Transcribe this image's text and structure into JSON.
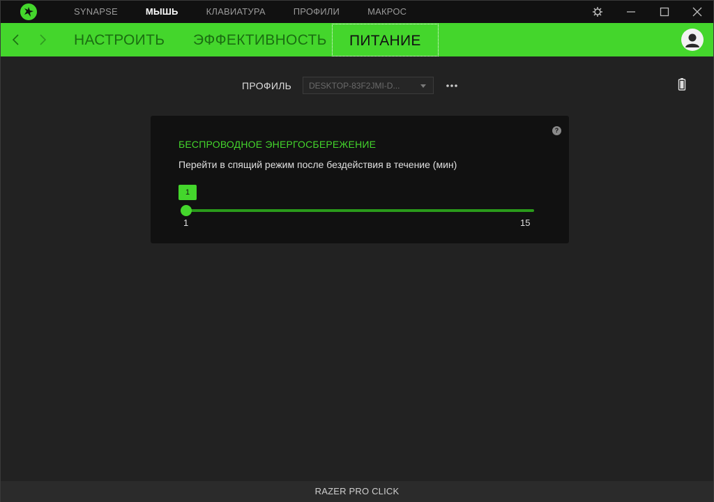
{
  "topnav": {
    "items": [
      {
        "label": "SYNAPSE",
        "active": false
      },
      {
        "label": "МЫШЬ",
        "active": true
      },
      {
        "label": "КЛАВИАТУРА",
        "active": false
      },
      {
        "label": "ПРОФИЛИ",
        "active": false
      },
      {
        "label": "МАКРОС",
        "active": false
      }
    ]
  },
  "subnav": {
    "tabs": [
      {
        "label": "НАСТРОИТЬ",
        "active": false
      },
      {
        "label": "ЭФФЕКТИВНОСТЬ",
        "active": false
      },
      {
        "label": "ПИТАНИЕ",
        "active": true
      }
    ]
  },
  "profile": {
    "label": "ПРОФИЛЬ",
    "selected": "DESKTOP-83F2JMI-D..."
  },
  "power": {
    "title": "БЕСПРОВОДНОЕ ЭНЕРГОСБЕРЕЖЕНИЕ",
    "description": "Перейти в спящий режим после бездействия в течение (мин)",
    "help": "?",
    "slider": {
      "value": 1,
      "value_label": "1",
      "min": 1,
      "max": 15,
      "min_label": "1",
      "max_label": "15"
    }
  },
  "footer": {
    "device_name": "RAZER PRO CLICK"
  },
  "colors": {
    "accent": "#44d62c",
    "background": "#222222",
    "card": "#111111"
  }
}
